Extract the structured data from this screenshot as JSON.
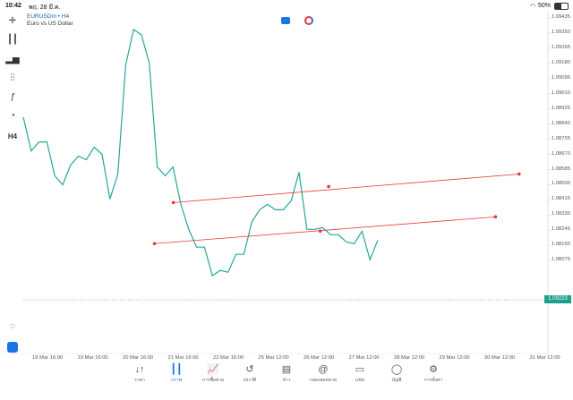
{
  "status": {
    "time": "10:42",
    "date": "พฤ. 28 มี.ค.",
    "battery": "50%",
    "wifi_icon": "wifi-icon",
    "battery_icon": "battery-icon"
  },
  "header": {
    "symbol": "EURUSDm • H4",
    "description": "Euro vs US Dollar"
  },
  "toolbar": {
    "icons": [
      "crosshair-icon",
      "candles-icon",
      "indicators-icon",
      "settings-sliders-icon",
      "function-icon",
      "shapes-icon"
    ],
    "timeframe": "H4"
  },
  "chart_data": {
    "type": "line",
    "title": "",
    "series_color": "#26a69a",
    "y_ticks": [
      "1.09435",
      "1.09350",
      "1.09265",
      "1.09180",
      "1.09095",
      "1.09010",
      "1.08925",
      "1.08840",
      "1.08755",
      "1.08670",
      "1.08585",
      "1.08500",
      "1.08415",
      "1.08330",
      "1.08245",
      "1.08160",
      "1.08075"
    ],
    "x_ticks": [
      "18 Mar 16:00",
      "19 Mar 16:00",
      "20 Mar 16:00",
      "21 Mar 16:00",
      "22 Mar 16:00",
      "25 Mar 12:00",
      "26 Mar 12:00",
      "27 Mar 12:00",
      "28 Mar 12:00",
      "29 Mar 12:00",
      "30 Mar 12:00",
      "31 Mar 12:00"
    ],
    "ylim": [
      1.0802,
      1.0948
    ],
    "values": [
      1.0888,
      1.0869,
      1.0874,
      1.0874,
      1.0855,
      1.085,
      1.0861,
      1.0866,
      1.0864,
      1.0871,
      1.0867,
      1.0842,
      1.0856,
      1.0917,
      1.0937,
      1.0934,
      1.0918,
      1.086,
      1.0855,
      1.086,
      1.0839,
      1.0825,
      1.0815,
      1.0815,
      1.0799,
      1.0802,
      1.0801,
      1.0811,
      1.0811,
      1.0829,
      1.0836,
      1.0839,
      1.0836,
      1.0836,
      1.0841,
      1.0857,
      1.0825,
      1.0825,
      1.0826,
      1.0822,
      1.0822,
      1.0818,
      1.0817,
      1.0824,
      1.0808,
      1.0819
    ],
    "current_price": "1.09223",
    "trendlines": [
      {
        "from": [
          0.286,
          1.084
        ],
        "mid": [
          0.582,
          1.0849
        ],
        "to": [
          0.945,
          1.0856
        ],
        "color": "#e53935"
      },
      {
        "from": [
          0.25,
          1.0817
        ],
        "mid": [
          0.566,
          1.0824
        ],
        "to": [
          0.9,
          1.0832
        ],
        "color": "#e53935"
      }
    ]
  },
  "tabs": [
    {
      "label": "ราคา",
      "icon": "quotes-icon"
    },
    {
      "label": "กราฟ",
      "icon": "chart-icon"
    },
    {
      "label": "การซื้อขาย",
      "icon": "trade-icon"
    },
    {
      "label": "ประวัติ",
      "icon": "history-icon"
    },
    {
      "label": "ข่าว",
      "icon": "news-icon"
    },
    {
      "label": "กล่องจดหมาย",
      "icon": "mailbox-icon"
    },
    {
      "label": "แชท",
      "icon": "chat-icon"
    },
    {
      "label": "บัญชี",
      "icon": "account-icon"
    },
    {
      "label": "การตั้งค่า",
      "icon": "settings-icon"
    }
  ]
}
